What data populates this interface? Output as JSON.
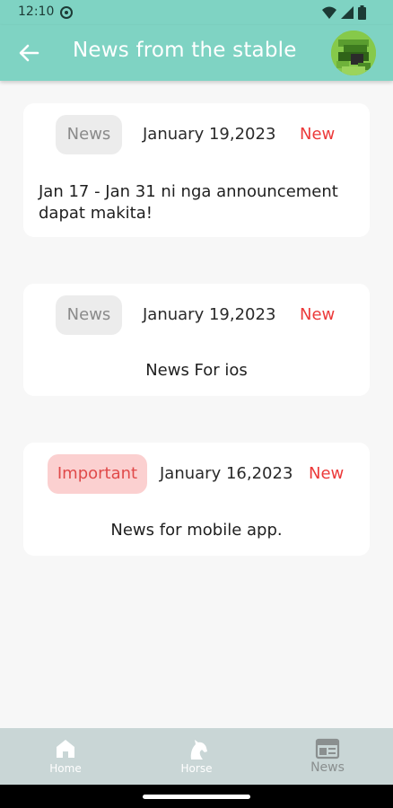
{
  "status_bar": {
    "time": "12:10"
  },
  "app_bar": {
    "title": "News from the stable"
  },
  "news": [
    {
      "tag": "News",
      "tag_type": "news",
      "date": "January 19,2023",
      "status": "New",
      "body": "Jan 17 - Jan 31 ni nga announcement dapat makita!"
    },
    {
      "tag": "News",
      "tag_type": "news",
      "date": "January 19,2023",
      "status": "New",
      "body": "News For ios"
    },
    {
      "tag": "Important",
      "tag_type": "important",
      "date": "January 16,2023",
      "status": "New",
      "body": "News for mobile app."
    }
  ],
  "bottom_nav": {
    "items": [
      {
        "label": "Home",
        "icon": "home-icon"
      },
      {
        "label": "Horse",
        "icon": "horse-icon"
      },
      {
        "label": "News",
        "icon": "newspaper-icon"
      }
    ],
    "active": "News"
  },
  "colors": {
    "accent": "#7fd3c3",
    "new": "#ec3a3a",
    "important_bg": "#fbd0d0",
    "nav_bg": "#c9d6d6"
  }
}
